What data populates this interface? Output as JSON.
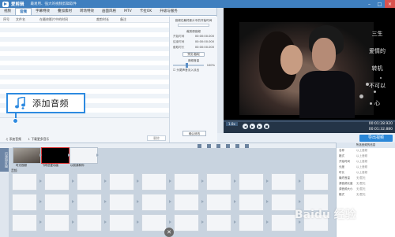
{
  "titlebar": {
    "app_name": "爱剪辑",
    "subtitle": "最易用、强大的视频剪辑软件"
  },
  "tabs": [
    "视频",
    "音频",
    "字幕特效",
    "叠加素材",
    "转场特效",
    "画面风格",
    "MTV",
    "卡拉OK",
    "升级与服务"
  ],
  "list": {
    "columns": [
      "序号",
      "文件名",
      "在最终影片中的时间",
      "裁剪时长",
      "备注"
    ]
  },
  "settings": {
    "section1": "音频在最终影片中的开始时间",
    "section2": "裁剪原音频",
    "fields": [
      "开始时间",
      "结束时间",
      "截取时长"
    ],
    "time_value": "00:00:00.000",
    "preview_button": "预览/截取",
    "volume_label": "音频音量",
    "volume_value": "100%",
    "fade_in": "头尾声音淡入淡出",
    "confirm_button": "确认修改"
  },
  "footer_buttons": {
    "add_audio": "添加音频",
    "download_music": "下载更多音乐",
    "delete": "删除"
  },
  "callout": {
    "label": "添加音频"
  },
  "preview": {
    "lyrics": [
      "三生",
      "爱情的",
      "转机",
      "不可以",
      "心"
    ],
    "speed": "1.0x",
    "time_current": "00:01:28.920",
    "time_total": "00:01:32.880"
  },
  "export": {
    "label": "导出视频"
  },
  "storyboard": {
    "side_label": "已添加片段",
    "clips": [
      {
        "label": "时光视频"
      },
      {
        "label": "飞吻恋爱动画"
      },
      {
        "label": "以前我和你"
      }
    ],
    "rows": [
      "音频"
    ]
  },
  "props": {
    "header": "所选音频的信息",
    "lines": [
      {
        "k": "名称",
        "v": "以上音频"
      },
      {
        "k": "格式",
        "v": "以上音频"
      },
      {
        "k": "开始时间",
        "v": "以上音频"
      },
      {
        "k": "长度",
        "v": "以上音频"
      },
      {
        "k": "时长",
        "v": "以上音频"
      },
      {
        "k": "最终音量",
        "v": "无/暂无"
      },
      {
        "k": "源音频长度",
        "v": "无/暂无"
      },
      {
        "k": "源音频大小",
        "v": "无/暂无"
      },
      {
        "k": "格式",
        "v": "无/暂无"
      }
    ]
  },
  "watermark": "Baidu 经验"
}
